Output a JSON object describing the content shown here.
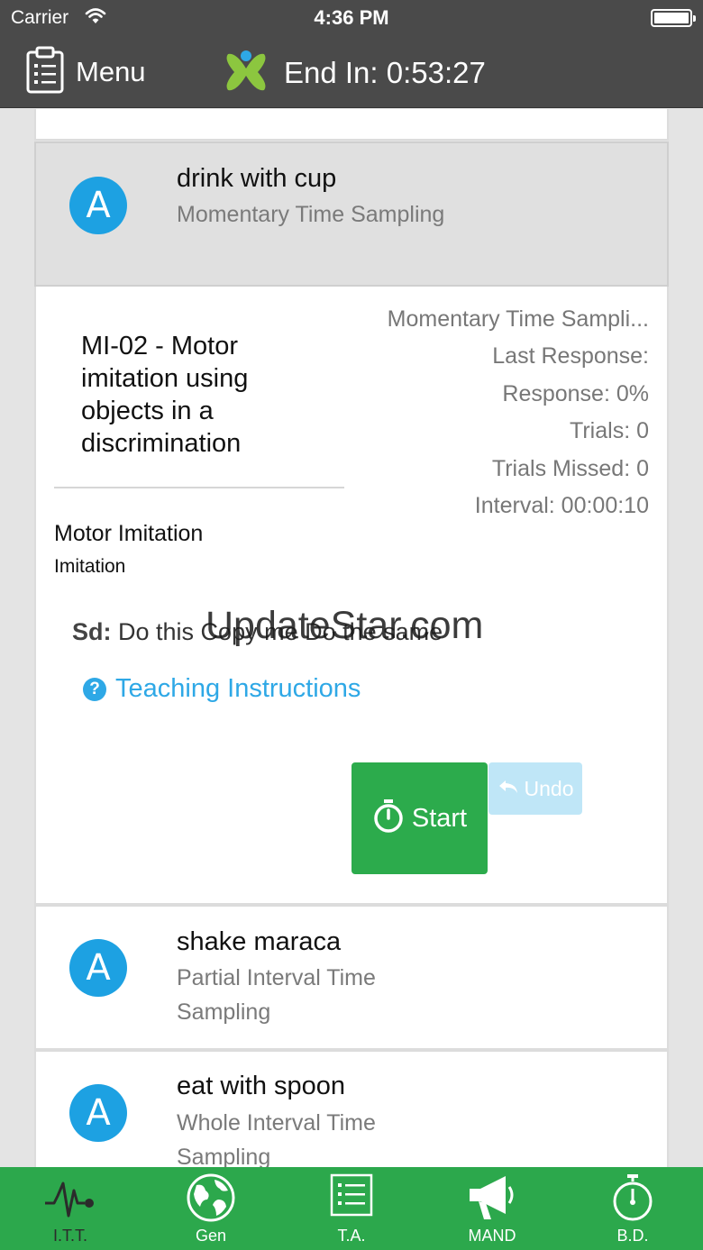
{
  "status_bar": {
    "carrier": "Carrier",
    "time": "4:36 PM",
    "battery_level": 1.0
  },
  "nav": {
    "menu_label": "Menu",
    "end_in": "End In: 0:53:27",
    "icons": {
      "menu": "clipboard-icon",
      "logo": "app-logo-icon"
    }
  },
  "colors": {
    "bar_dark": "#4a4a4a",
    "avatar_blue": "#1da1e2",
    "link_blue": "#2ea8e6",
    "start_green": "#2cab4c",
    "tab_green": "#2ca84c",
    "undo_disabled": "#bfe6f7"
  },
  "targets": [
    {
      "avatar": "A",
      "title": "drink with cup",
      "subtitle": "Momentary Time Sampling",
      "selected": true
    },
    {
      "avatar": "A",
      "title": "shake maraca",
      "subtitle": "Partial Interval Time Sampling",
      "selected": false
    },
    {
      "avatar": "A",
      "title": "eat with spoon",
      "subtitle": "Whole Interval Time Sampling",
      "selected": false
    }
  ],
  "detail": {
    "program_title": "MI-02 - Motor imitation using objects in a discrimination",
    "domain": "Motor Imitation",
    "subdomain": "Imitation",
    "stats": {
      "method": "Momentary Time Sampli...",
      "last_response": "Last Response:",
      "response": "Response: 0%",
      "trials": "Trials: 0",
      "trials_missed": "Trials Missed: 0",
      "interval": "Interval: 00:00:10"
    },
    "sd_label": "Sd:",
    "sd_text": "Do this Copy me Do the same",
    "watermark": "UpdateStar.com",
    "teaching_instructions": "Teaching Instructions",
    "start_label": "Start",
    "undo_label": "Undo"
  },
  "tabs": [
    {
      "label": "I.T.T.",
      "icon": "pulse-icon"
    },
    {
      "label": "Gen",
      "icon": "globe-icon"
    },
    {
      "label": "T.A.",
      "icon": "list-icon"
    },
    {
      "label": "MAND",
      "icon": "megaphone-icon"
    },
    {
      "label": "B.D.",
      "icon": "stopwatch-icon"
    }
  ]
}
